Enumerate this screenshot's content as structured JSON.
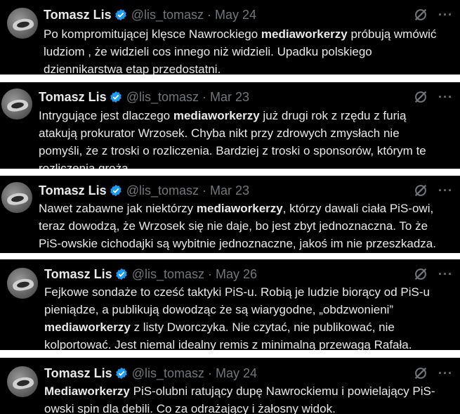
{
  "tweets": [
    {
      "author": "Tomasz Lis",
      "handle": "@lis_tomasz",
      "separator": "·",
      "date": "May 24",
      "lines": [
        [
          "Po kompromitującej klęsce Nawrockiego ",
          "mediaworkerzy",
          " próbują wmówić"
        ],
        [
          "ludziom , że widzieli cos innego niż widzieli. Upadku polskiego",
          "",
          ""
        ],
        [
          "dziennikarstwa etap przedostatni.",
          "",
          ""
        ]
      ]
    },
    {
      "author": "Tomasz Lis",
      "handle": "@lis_tomasz",
      "separator": "·",
      "date": "Mar 23",
      "lines": [
        [
          "Intrygujące jest dlaczego ",
          "mediaworkerzy",
          "  już drugi rok z rzędu z furią"
        ],
        [
          "atakują prokurator Wrzosek. Chyba nikt przy zdrowych zmysłach nie",
          "",
          ""
        ],
        [
          "pomyśli, że z troski o rozliczenia. Bardziej  z troski o sponsorów, którym te",
          "",
          ""
        ],
        [
          "rozliczenia grożą.",
          "",
          ""
        ]
      ]
    },
    {
      "author": "Tomasz Lis",
      "handle": "@lis_tomasz",
      "separator": "·",
      "date": "Mar 23",
      "lines": [
        [
          "Nawet zabawne jak niektórzy ",
          "mediaworkerzy",
          ", którzy dawali ciała PiS-owi,"
        ],
        [
          "teraz dowodzą, że Wrzosek się nie daje, bo jest zbyt jednoznaczna. To że",
          "",
          ""
        ],
        [
          "PiS-owskie cichodajki są wybitnie jednoznaczne, jakoś im nie przeszkadza.",
          "",
          ""
        ]
      ]
    },
    {
      "author": "Tomasz Lis",
      "handle": "@lis_tomasz",
      "separator": "·",
      "date": "May 26",
      "lines": [
        [
          "Fejkowe sondaże to cześć taktyki PiS-u. Robią je ludzie biorący od PiS-u",
          "",
          ""
        ],
        [
          "pieniądze, a publikują dowodząc że są wiarygodne, „obdzwonieni”",
          "",
          ""
        ],
        [
          "",
          "mediaworkerzy",
          " z listy Dworczyka. Nie czytać, nie publikować, nie"
        ],
        [
          "kolportować. Jest niemal idealny remis z minimalną przewagą Rafała.",
          "",
          ""
        ]
      ]
    },
    {
      "author": "Tomasz Lis",
      "handle": "@lis_tomasz",
      "separator": "·",
      "date": "May 24",
      "lines": [
        [
          "",
          "Mediaworkerzy",
          " PiS-olubni ratujący dupę  Nawrockiemu i powielający PiS-"
        ],
        [
          "owski spin dla debili. Co za odrażający i żałosny widok.",
          "",
          ""
        ]
      ]
    }
  ],
  "icons": {
    "verified": "verified-badge-icon",
    "grok": "grok-icon",
    "more": "more-icon",
    "more_glyph": "···"
  },
  "colors": {
    "background": "#000000",
    "text": "#e7e9ea",
    "muted": "#71767b",
    "verified": "#1d9bf0"
  }
}
